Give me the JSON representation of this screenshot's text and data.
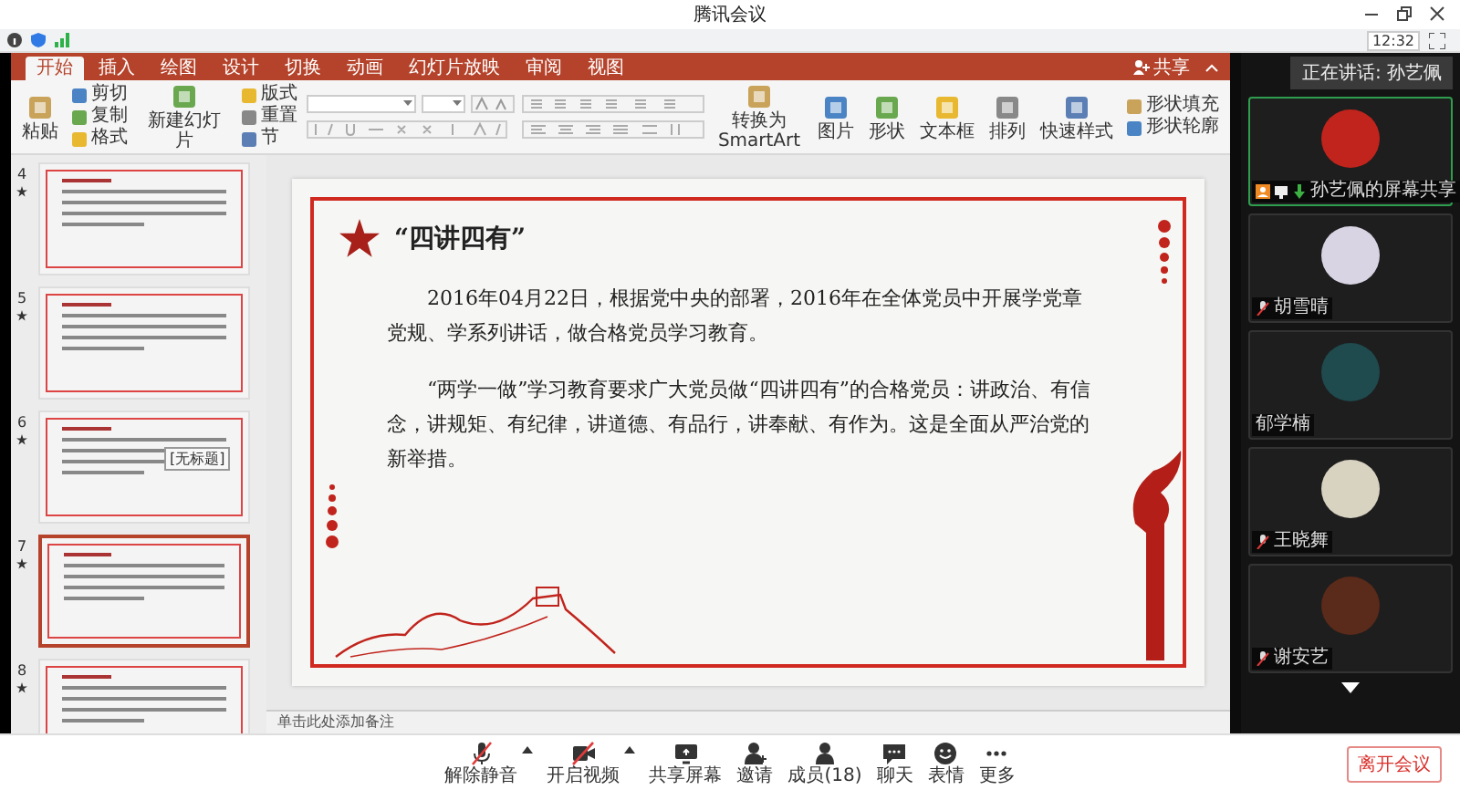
{
  "window": {
    "title": "腾讯会议",
    "clock": "12:32"
  },
  "ribbon": {
    "tabs": [
      {
        "label": "开始",
        "selected": true
      },
      {
        "label": "插入",
        "selected": false
      },
      {
        "label": "绘图",
        "selected": false
      },
      {
        "label": "设计",
        "selected": false
      },
      {
        "label": "切换",
        "selected": false
      },
      {
        "label": "动画",
        "selected": false
      },
      {
        "label": "幻灯片放映",
        "selected": false
      },
      {
        "label": "审阅",
        "selected": false
      },
      {
        "label": "视图",
        "selected": false
      }
    ],
    "share": "共享",
    "groups": [
      {
        "kind": "large",
        "label": "粘贴"
      },
      {
        "kind": "stack",
        "items": [
          {
            "label": "剪切"
          },
          {
            "label": "复制"
          },
          {
            "label": "格式"
          }
        ]
      },
      {
        "kind": "large",
        "label": "新建幻灯片"
      },
      {
        "kind": "stack",
        "items": [
          {
            "label": "版式"
          },
          {
            "label": "重置"
          },
          {
            "label": "节"
          }
        ]
      },
      {
        "kind": "font"
      },
      {
        "kind": "para"
      },
      {
        "kind": "large",
        "label": "转换为SmartArt"
      },
      {
        "kind": "large",
        "label": "图片"
      },
      {
        "kind": "large",
        "label": "形状"
      },
      {
        "kind": "large",
        "label": "文本框"
      },
      {
        "kind": "large",
        "label": "排列"
      },
      {
        "kind": "large",
        "label": "快速样式"
      },
      {
        "kind": "stack",
        "items": [
          {
            "label": "形状填充"
          },
          {
            "label": "形状轮廓"
          }
        ]
      }
    ]
  },
  "thumbnails": [
    {
      "number": "4",
      "selected": false
    },
    {
      "number": "5",
      "selected": false
    },
    {
      "number": "6",
      "selected": false
    },
    {
      "number": "7",
      "selected": true
    },
    {
      "number": "8",
      "selected": false
    }
  ],
  "tooltip": "[无标题]",
  "slide": {
    "title": "“四讲四有”",
    "paragraphs": [
      "2016年04月22日，根据党中央的部署，2016年在全体党员中开展学党章党规、学系列讲话，做合格党员学习教育。",
      "“两学一做”学习教育要求广大党员做“四讲四有”的合格党员：讲政治、有信念，讲规矩、有纪律，讲道德、有品行，讲奉献、有作为。这是全面从严治党的新举措。"
    ]
  },
  "notes_placeholder": "单击此处添加备注",
  "meeting": {
    "speaking": "正在讲话: 孙艺佩",
    "participants": [
      {
        "name": "孙艺佩的屏幕共享",
        "sharing": true,
        "muted": false,
        "selected": true
      },
      {
        "name": "胡雪晴",
        "sharing": false,
        "muted": true,
        "selected": false
      },
      {
        "name": "郁学楠",
        "sharing": false,
        "muted": false,
        "selected": false
      },
      {
        "name": "王晓舞",
        "sharing": false,
        "muted": true,
        "selected": false
      },
      {
        "name": "谢安艺",
        "sharing": false,
        "muted": true,
        "selected": false
      }
    ]
  },
  "toolbar": {
    "buttons": [
      {
        "kind": "mic",
        "label": "解除静音",
        "menu": true
      },
      {
        "kind": "camera",
        "label": "开启视频",
        "menu": true
      },
      {
        "kind": "screen",
        "label": "共享屏幕",
        "menu": false
      },
      {
        "kind": "invite",
        "label": "邀请",
        "menu": false
      },
      {
        "kind": "members",
        "label": "成员(18)",
        "menu": false
      },
      {
        "kind": "chat",
        "label": "聊天",
        "menu": false
      },
      {
        "kind": "emoji",
        "label": "表情",
        "menu": false
      },
      {
        "kind": "more",
        "label": "更多",
        "menu": false
      }
    ],
    "leave": "离开会议"
  }
}
